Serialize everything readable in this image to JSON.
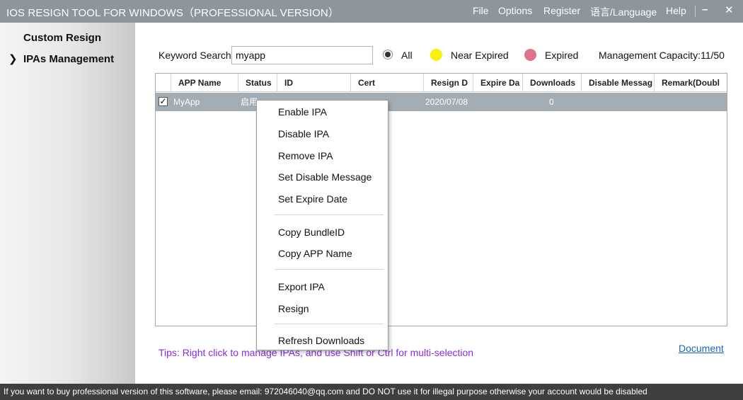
{
  "window": {
    "title": "IOS RESIGN TOOL FOR WINDOWS（PROFESSIONAL VERSION）",
    "menu": [
      "File",
      "Options",
      "Register",
      "语言/Language",
      "Help"
    ],
    "minimize_glyph": "–",
    "close_glyph": "✕"
  },
  "sidebar": {
    "items": [
      {
        "label": "Custom Resign",
        "active": false
      },
      {
        "label": "IPAs Management",
        "active": true
      }
    ],
    "arrow_glyph": "❯"
  },
  "search": {
    "label": "Keyword Search",
    "value": "myapp"
  },
  "filter": {
    "all_label": "All",
    "all_selected": true,
    "near_expired_label": "Near Expired",
    "near_expired_color": "#f7f209",
    "expired_label": "Expired",
    "expired_color": "#e0728c"
  },
  "capacity": "Management Capacity:11/50",
  "table": {
    "columns": [
      "APP Name",
      "Status",
      "ID",
      "Cert",
      "Resign D",
      "Expire Da",
      "Downloads",
      "Disable Messag",
      "Remark(Doubl"
    ],
    "rows": [
      {
        "checked": true,
        "check_glyph": "✓",
        "app_name": "MyApp",
        "status": "启用",
        "resign_date": "2020/07/08",
        "downloads": "0"
      }
    ]
  },
  "context_menu": {
    "items": [
      "Enable IPA",
      "Disable IPA",
      "Remove IPA",
      "Set Disable Message",
      "Set Expire Date",
      "Copy BundleID",
      "Copy APP Name",
      "Export IPA",
      "Resign",
      "Refresh Downloads"
    ]
  },
  "tips": "Tips: Right click to manage IPAs, and use Shift or Ctrl for multi-selection",
  "document_link": "Document",
  "status_bar": "If you want to buy professional version of this software, please email: 972046040@qq.com and DO NOT use it for illegal purpose otherwise your account would be disabled"
}
